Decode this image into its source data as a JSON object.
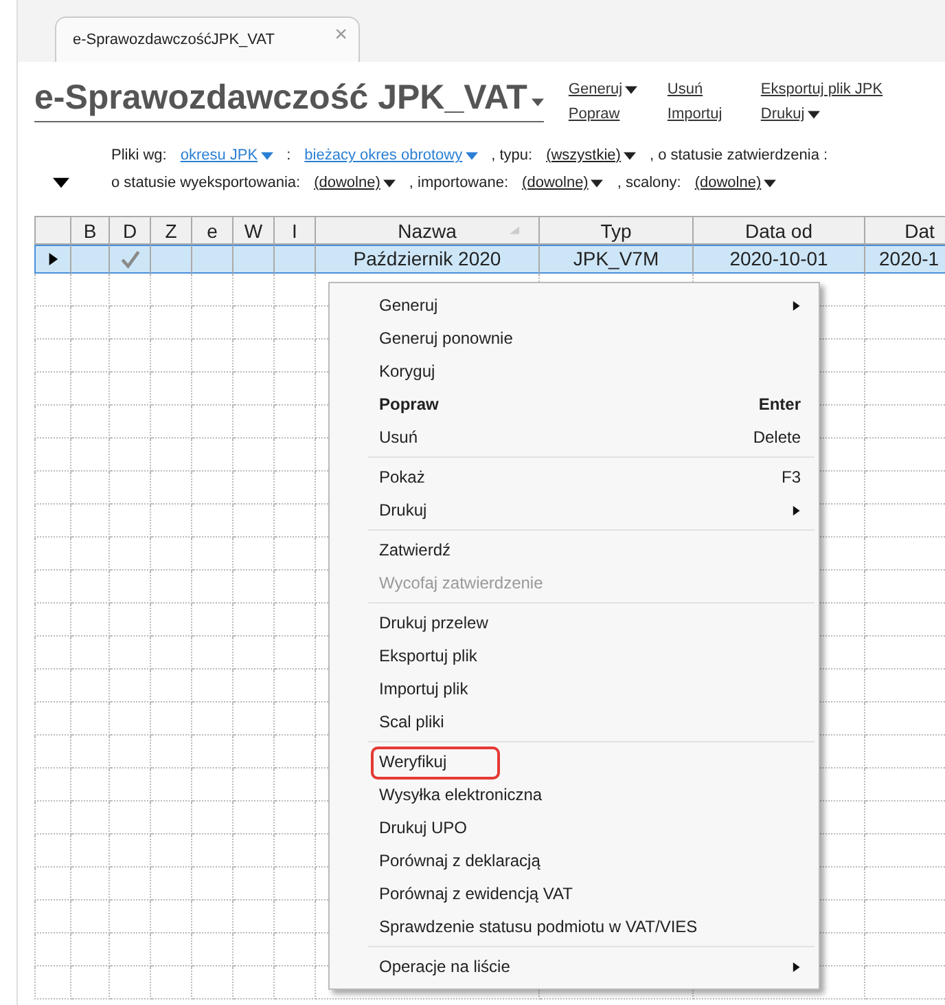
{
  "tab": {
    "label": "e-SprawozdawczośćJPK_VAT",
    "closable": true,
    "close": "×"
  },
  "header": {
    "title": "e-Sprawozdawczość JPK_VAT",
    "title_dropdown": true,
    "actions": [
      {
        "label": "Generuj",
        "dropdown": true
      },
      {
        "label": "Usuń",
        "dropdown": false
      },
      {
        "label": "Eksportuj plik JPK",
        "dropdown": false
      },
      {
        "label": "Popraw",
        "dropdown": false
      },
      {
        "label": "Importuj",
        "dropdown": false
      },
      {
        "label": "Drukuj",
        "dropdown": true
      }
    ]
  },
  "filters": {
    "expanded": true,
    "lines": [
      [
        {
          "kind": "label",
          "text": "Pliki wg:"
        },
        {
          "kind": "link",
          "text": "okresu JPK"
        },
        {
          "kind": "label",
          "text": ":"
        },
        {
          "kind": "link",
          "text": "bieżacy okres obrotowy"
        },
        {
          "kind": "label",
          "text": ", typu:"
        },
        {
          "kind": "value",
          "text": "(wszystkie)"
        },
        {
          "kind": "label",
          "text": ", o statusie zatwierdzenia :"
        }
      ],
      [
        {
          "kind": "label",
          "text": "o statusie wyeksportowania:"
        },
        {
          "kind": "value",
          "text": "(dowolne)"
        },
        {
          "kind": "label",
          "text": ", importowane:"
        },
        {
          "kind": "value",
          "text": "(dowolne)"
        },
        {
          "kind": "label",
          "text": ", scalony:"
        },
        {
          "kind": "value",
          "text": "(dowolne)"
        }
      ]
    ]
  },
  "table": {
    "columns": [
      {
        "label": "B",
        "sorted": false
      },
      {
        "label": "D",
        "sorted": false
      },
      {
        "label": "Z",
        "sorted": false
      },
      {
        "label": "e",
        "sorted": false
      },
      {
        "label": "W",
        "sorted": false
      },
      {
        "label": "I",
        "sorted": false
      },
      {
        "label": "Nazwa",
        "sorted": true
      },
      {
        "label": "Typ",
        "sorted": false
      },
      {
        "label": "Data od",
        "sorted": false
      },
      {
        "label": "Dat",
        "sorted": false
      }
    ],
    "rows": [
      {
        "selected": true,
        "current": true,
        "flags": [
          false,
          true,
          false,
          false,
          false,
          false
        ],
        "cells": [
          "",
          "",
          "",
          "",
          "",
          "",
          "Październik 2020",
          "JPK_V7M",
          "2020-10-01",
          "2020-1"
        ]
      }
    ]
  },
  "context_menu": {
    "items": [
      {
        "kind": "item",
        "label": "Generuj",
        "submenu": true,
        "bold": false,
        "disabled": false,
        "highlighted": false
      },
      {
        "kind": "item",
        "label": "Generuj ponownie",
        "submenu": false,
        "bold": false,
        "disabled": false,
        "highlighted": false
      },
      {
        "kind": "item",
        "label": "Koryguj",
        "submenu": false,
        "bold": false,
        "disabled": false,
        "highlighted": false
      },
      {
        "kind": "item",
        "label": "Popraw",
        "shortcut": "Enter",
        "submenu": false,
        "bold": true,
        "disabled": false,
        "highlighted": false
      },
      {
        "kind": "item",
        "label": "Usuń",
        "shortcut": "Delete",
        "submenu": false,
        "bold": false,
        "disabled": false,
        "highlighted": false
      },
      {
        "kind": "separator"
      },
      {
        "kind": "item",
        "label": "Pokaż",
        "shortcut": "F3",
        "submenu": false,
        "bold": false,
        "disabled": false,
        "highlighted": false
      },
      {
        "kind": "item",
        "label": "Drukuj",
        "submenu": true,
        "bold": false,
        "disabled": false,
        "highlighted": false
      },
      {
        "kind": "separator"
      },
      {
        "kind": "item",
        "label": "Zatwierdź",
        "submenu": false,
        "bold": false,
        "disabled": false,
        "highlighted": false
      },
      {
        "kind": "item",
        "label": "Wycofaj zatwierdzenie",
        "submenu": false,
        "bold": false,
        "disabled": true,
        "highlighted": false
      },
      {
        "kind": "separator"
      },
      {
        "kind": "item",
        "label": "Drukuj przelew",
        "submenu": false,
        "bold": false,
        "disabled": false,
        "highlighted": false
      },
      {
        "kind": "item",
        "label": "Eksportuj plik",
        "submenu": false,
        "bold": false,
        "disabled": false,
        "highlighted": false
      },
      {
        "kind": "item",
        "label": "Importuj plik",
        "submenu": false,
        "bold": false,
        "disabled": false,
        "highlighted": false
      },
      {
        "kind": "item",
        "label": "Scal pliki",
        "submenu": false,
        "bold": false,
        "disabled": false,
        "highlighted": false
      },
      {
        "kind": "separator"
      },
      {
        "kind": "item",
        "label": "Weryfikuj",
        "submenu": false,
        "bold": false,
        "disabled": false,
        "highlighted": true
      },
      {
        "kind": "item",
        "label": "Wysyłka elektroniczna",
        "submenu": false,
        "bold": false,
        "disabled": false,
        "highlighted": false
      },
      {
        "kind": "item",
        "label": "Drukuj UPO",
        "submenu": false,
        "bold": false,
        "disabled": false,
        "highlighted": false
      },
      {
        "kind": "item",
        "label": "Porównaj z deklaracją",
        "submenu": false,
        "bold": false,
        "disabled": false,
        "highlighted": false
      },
      {
        "kind": "item",
        "label": "Porównaj z ewidencją VAT",
        "submenu": false,
        "bold": false,
        "disabled": false,
        "highlighted": false
      },
      {
        "kind": "item",
        "label": "Sprawdzenie statusu podmiotu w VAT/VIES",
        "submenu": false,
        "bold": false,
        "disabled": false,
        "highlighted": false
      },
      {
        "kind": "separator"
      },
      {
        "kind": "item",
        "label": "Operacje na liście",
        "submenu": true,
        "bold": false,
        "disabled": false,
        "highlighted": false
      }
    ]
  }
}
